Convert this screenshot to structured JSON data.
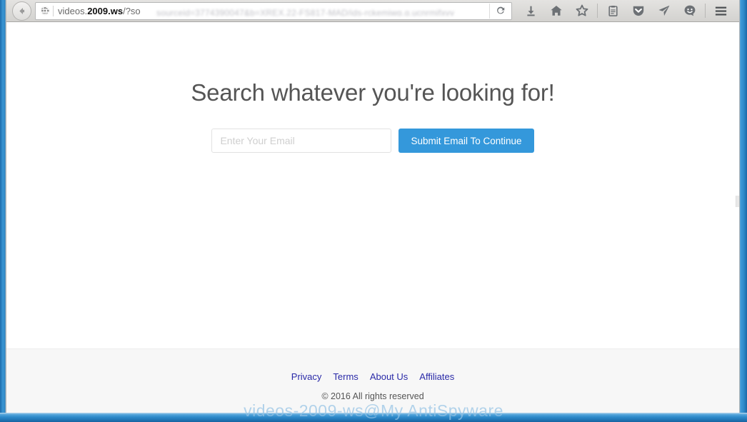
{
  "browser": {
    "back_button": "Back",
    "identity_icon": "globe-icon",
    "url": {
      "prefix": "videos.",
      "domain": "2009.ws",
      "path": "/?so",
      "blurred_tail": "sourceid=3774390047&b=XREX.22-FS817-MAD/ids-rckemiwg.g.ucnrmifxvv"
    },
    "reload_label": "Reload",
    "toolbar_icons": [
      {
        "name": "downloads-icon",
        "glyph": "download"
      },
      {
        "name": "home-icon",
        "glyph": "home"
      },
      {
        "name": "bookmark-star-icon",
        "glyph": "star"
      },
      {
        "name": "reader-list-icon",
        "glyph": "clipboard"
      },
      {
        "name": "pocket-icon",
        "glyph": "shield"
      },
      {
        "name": "send-tab-icon",
        "glyph": "paper-plane"
      },
      {
        "name": "feedback-smiley-icon",
        "glyph": "smiley"
      },
      {
        "name": "menu-icon",
        "glyph": "hamburger"
      }
    ]
  },
  "page": {
    "heading": "Search whatever you're looking for!",
    "email_placeholder": "Enter Your Email",
    "email_value": "",
    "submit_label": "Submit Email To Continue",
    "footer": {
      "links": [
        {
          "label": "Privacy"
        },
        {
          "label": "Terms"
        },
        {
          "label": "About Us"
        },
        {
          "label": "Affiliates"
        }
      ],
      "copyright": "© 2016 All rights reserved"
    }
  },
  "watermark": "videos-2009-ws@My AntiSpyware",
  "colors": {
    "accent_blue": "#3498db",
    "frame_blue": "#2f8ccd",
    "heading_gray": "#555555",
    "link_navy": "#2a2aa8",
    "footer_bg": "#f7f7f7"
  }
}
